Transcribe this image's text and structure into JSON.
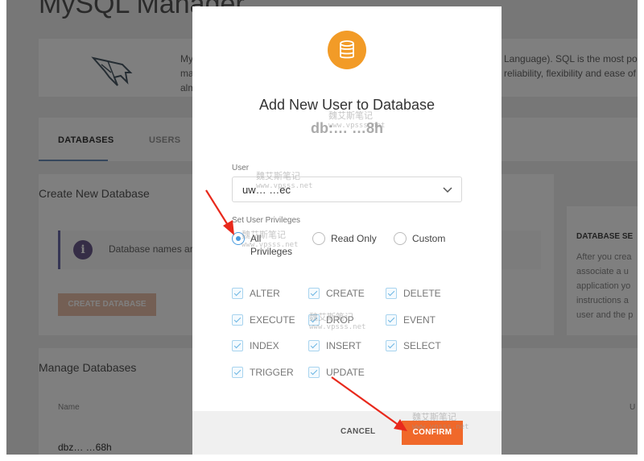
{
  "background": {
    "title": "MySQL Manager",
    "intro_text_left": "My\nma\nalm",
    "intro_text_right": "Language). SQL is the most pop\nreliability, flexibility and ease of",
    "tabs": [
      {
        "label": "DATABASES"
      },
      {
        "label": "USERS"
      }
    ],
    "create_heading": "Create New Database",
    "notice_text": "Database names are",
    "create_button": "CREATE DATABASE",
    "side_title": "DATABASE SE",
    "side_text": "After you crea\nassociate a u\napplication yo\ninstructions a\nuser and the p",
    "manage_heading": "Manage Databases",
    "table_col_name": "Name",
    "table_col_right": "U",
    "table_row_name": "dbz… …68h"
  },
  "modal": {
    "icon": "database-icon",
    "title": "Add New User to Database",
    "subtitle": "db:… …8h",
    "user_label": "User",
    "user_value": "uw… …ec",
    "privileges_label": "Set User Privileges",
    "radio_options": [
      {
        "label": "All\nPrivileges",
        "selected": true
      },
      {
        "label": "Read Only",
        "selected": false
      },
      {
        "label": "Custom",
        "selected": false
      }
    ],
    "permissions": [
      {
        "label": "ALTER",
        "checked": true
      },
      {
        "label": "CREATE",
        "checked": true
      },
      {
        "label": "DELETE",
        "checked": true
      },
      {
        "label": "EXECUTE",
        "checked": true
      },
      {
        "label": "DROP",
        "checked": true
      },
      {
        "label": "EVENT",
        "checked": true
      },
      {
        "label": "INDEX",
        "checked": true
      },
      {
        "label": "INSERT",
        "checked": true
      },
      {
        "label": "SELECT",
        "checked": true
      },
      {
        "label": "TRIGGER",
        "checked": true
      },
      {
        "label": "UPDATE",
        "checked": true
      }
    ],
    "cancel_label": "CANCEL",
    "confirm_label": "CONFIRM"
  },
  "watermark": {
    "cn": "魏艾斯笔记",
    "url": "www.vpsss.net"
  },
  "colors": {
    "accent": "#f0682a",
    "icon_bg": "#f29b27",
    "radio": "#4a9ce0",
    "arrow": "#e8291c"
  }
}
